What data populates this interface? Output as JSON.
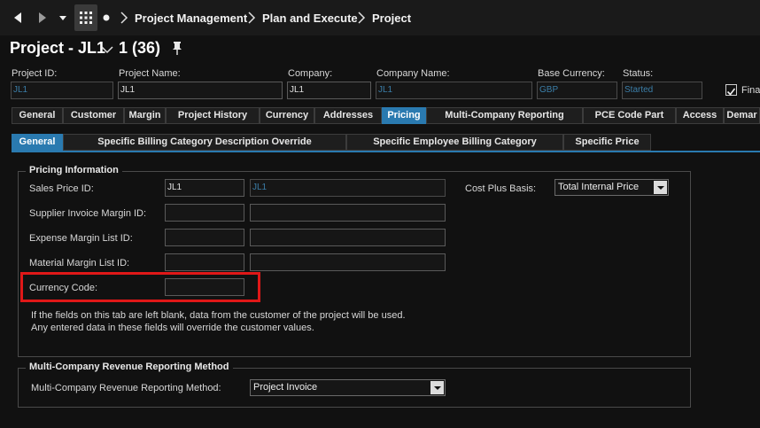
{
  "breadcrumb": {
    "items": [
      "Project Management",
      "Plan and Execute",
      "Project"
    ]
  },
  "page": {
    "title": "Project - JL1",
    "count": "1 (36)"
  },
  "header": {
    "project_id": {
      "label": "Project ID:",
      "value": "JL1"
    },
    "project_name": {
      "label": "Project Name:",
      "value": "JL1"
    },
    "company": {
      "label": "Company:",
      "value": "JL1"
    },
    "company_name": {
      "label": "Company Name:",
      "value": "JL1"
    },
    "base_currency": {
      "label": "Base Currency:",
      "value": "GBP"
    },
    "status": {
      "label": "Status:",
      "value": "Started"
    },
    "final_checkbox": {
      "label": "Fina",
      "checked": true
    }
  },
  "tabs": [
    {
      "label": "General"
    },
    {
      "label": "Customer"
    },
    {
      "label": "Margin"
    },
    {
      "label": "Project History"
    },
    {
      "label": "Currency"
    },
    {
      "label": "Addresses"
    },
    {
      "label": "Pricing",
      "active": true
    },
    {
      "label": "Multi-Company Reporting"
    },
    {
      "label": "PCE Code Part"
    },
    {
      "label": "Access"
    },
    {
      "label": "Demar"
    }
  ],
  "subtabs": [
    {
      "label": "General",
      "active": true
    },
    {
      "label": "Specific Billing Category Description Override"
    },
    {
      "label": "Specific Employee Billing Category"
    },
    {
      "label": "Specific Price"
    }
  ],
  "pricing": {
    "title": "Pricing Information",
    "sales_price_id": {
      "label": "Sales Price ID:",
      "value": "JL1",
      "description": "JL1"
    },
    "supplier_invoice_margin_id": {
      "label": "Supplier Invoice Margin ID:",
      "value": "",
      "description": ""
    },
    "expense_margin_list_id": {
      "label": "Expense Margin List ID:",
      "value": "",
      "description": ""
    },
    "material_margin_list_id": {
      "label": "Material Margin List ID:",
      "value": "",
      "description": ""
    },
    "currency_code": {
      "label": "Currency Code:",
      "value": ""
    },
    "cost_plus_basis": {
      "label": "Cost Plus Basis:",
      "value": "Total Internal Price"
    },
    "info_line1": "If the fields on this tab are left blank, data from the customer of the project will be used.",
    "info_line2": "Any entered data in these fields will override the customer values."
  },
  "multi_company": {
    "title": "Multi-Company Revenue Reporting Method",
    "method": {
      "label": "Multi-Company Revenue Reporting Method:",
      "value": "Project Invoice"
    }
  },
  "colors": {
    "accent": "#2a7ab0",
    "background": "#111111",
    "highlight": "#e01818",
    "readonly_text": "#3b7ea8"
  }
}
